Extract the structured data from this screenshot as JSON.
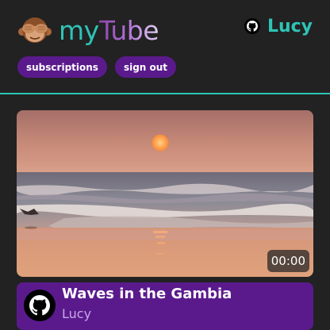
{
  "header": {
    "logo_icon": "see-no-evil-monkey-icon",
    "logo_part1": "my",
    "logo_part2": "Tube",
    "user": {
      "icon": "github-icon",
      "name": "Lucy"
    }
  },
  "nav": {
    "subscriptions_label": "subscriptions",
    "sign_out_label": "sign out"
  },
  "video": {
    "thumbnail": "beach-sunset",
    "duration": "00:00",
    "title": "Waves in the Gambia",
    "author": "Lucy",
    "author_icon": "github-icon"
  },
  "colors": {
    "background": "#222222",
    "accent": "#2ec4b6",
    "purple": "#5a1a8c"
  }
}
